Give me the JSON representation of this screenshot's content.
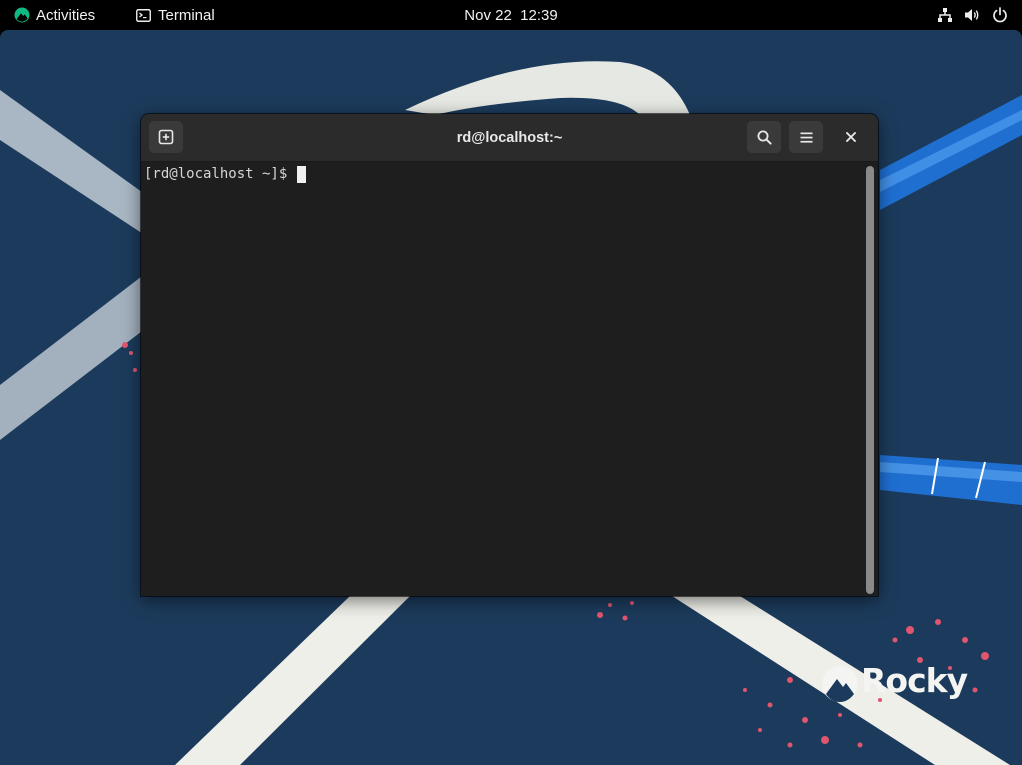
{
  "topbar": {
    "activities_label": "Activities",
    "app_label": "Terminal",
    "clock": "Nov 22  12:39",
    "tray_icons": [
      "network-icon",
      "volume-icon",
      "power-icon"
    ]
  },
  "desktop": {
    "brand_text": "Rocky",
    "colors": {
      "background": "#1c3b5c",
      "ribbon": "#efefe9",
      "accent_blue": "#1f6fd1",
      "splatter": "#e0566e"
    }
  },
  "terminal": {
    "title": "rd@localhost:~",
    "prompt": "[rd@localhost ~]$ ",
    "buttons": [
      "new-tab-icon",
      "search-icon",
      "menu-icon",
      "close-icon"
    ]
  },
  "colors": {
    "topbar": "#000000",
    "headerbar": "#2b2b2b",
    "terminal_bg": "#1e1e1e",
    "activities_logo": "#10b981"
  }
}
